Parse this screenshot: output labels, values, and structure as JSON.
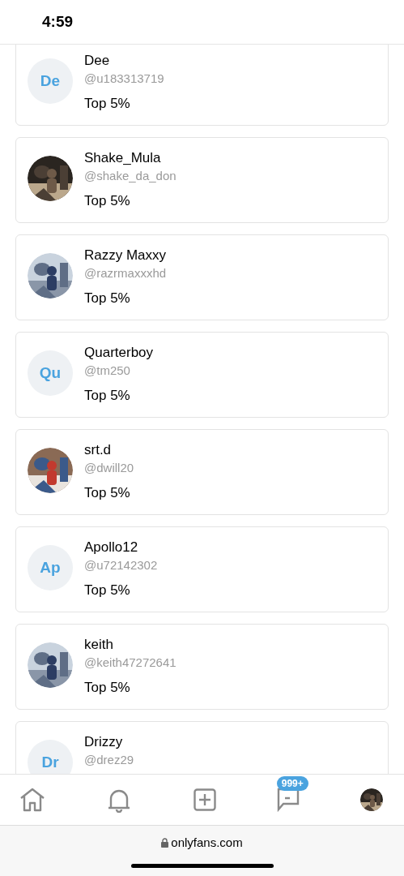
{
  "status_bar": {
    "time": "4:59"
  },
  "users": [
    {
      "name": "Dee",
      "handle": "@u183313719",
      "rank": "Top 5%",
      "avatar": {
        "kind": "initials",
        "initials": "De"
      }
    },
    {
      "name": "Shake_Mula",
      "handle": "@shake_da_don",
      "rank": "Top 5%"
    },
    {
      "name": "Razzy Maxxy",
      "handle": "@razrmaxxxhd",
      "rank": "Top 5%"
    },
    {
      "name": "Quarterboy",
      "handle": "@tm250",
      "rank": "Top 5%",
      "avatar": {
        "kind": "initials",
        "initials": "Qu"
      }
    },
    {
      "name": "srt.d",
      "handle": "@dwill20",
      "rank": "Top 5%"
    },
    {
      "name": "Apollo12",
      "handle": "@u72142302",
      "rank": "Top 5%",
      "avatar": {
        "kind": "initials",
        "initials": "Ap"
      }
    },
    {
      "name": "keith",
      "handle": "@keith47272641",
      "rank": "Top 5%"
    },
    {
      "name": "Drizzy",
      "handle": "@drez29",
      "avatar": {
        "kind": "initials",
        "initials": "Dr"
      }
    }
  ],
  "nav": {
    "messages_badge": "999+"
  },
  "browser": {
    "url": "onlyfans.com"
  }
}
